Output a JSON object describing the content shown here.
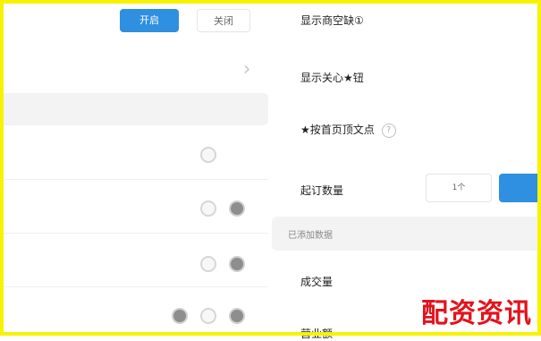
{
  "segmented": {
    "primary_label": "开启",
    "secondary_label": "关闭"
  },
  "settings": {
    "show_empty_label": "显示商空缺①",
    "show_favorite_label": "显示关心★钮",
    "sort_by_label": "★按首页顶文点",
    "purchase_qty_label": "起订数量",
    "qty_value": "1个"
  },
  "section": {
    "title": "已添加数据"
  },
  "list": {
    "item1": "成交量",
    "item2": "营业额"
  },
  "icons": {
    "chevron": "chevron-right-icon",
    "help": "question-circle-icon",
    "toggle": "radio-circle-icon"
  },
  "colors": {
    "accent": "#2f8fe0",
    "frame": "#f7f200",
    "watermark": "#e3121b"
  },
  "watermark": {
    "text": "配资资讯"
  }
}
